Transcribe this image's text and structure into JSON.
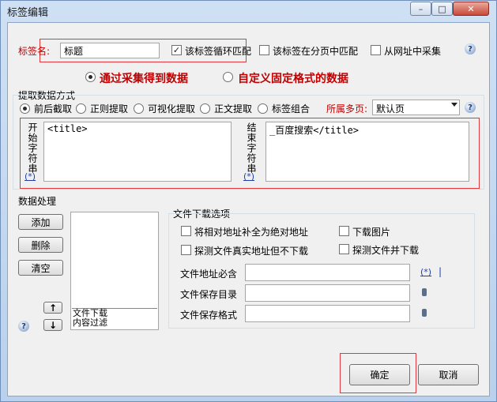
{
  "window": {
    "title": "标签编辑",
    "min": "–",
    "max": "□",
    "close": "✕"
  },
  "tagname": {
    "label": "标签名:",
    "value": "标题"
  },
  "options": {
    "loop_match": {
      "label": "该标签循环匹配",
      "checked": true
    },
    "in_pages": {
      "label": "该标签在分页中匹配",
      "checked": false
    },
    "from_url": {
      "label": "从网址中采集",
      "checked": false
    }
  },
  "mode": {
    "collect": "通过采集得到数据",
    "custom": "自定义固定格式的数据",
    "selected": "collect"
  },
  "extract": {
    "title": "提取数据方式",
    "methods": [
      "前后截取",
      "正则提取",
      "可视化提取",
      "正文提取",
      "标签组合"
    ],
    "selected_index": 0,
    "page_label": "所属多页:",
    "page_value": "默认页"
  },
  "start": {
    "label": "开始字符串",
    "star": "(*)",
    "value": "<title>"
  },
  "end": {
    "label": "结束字符串",
    "star": "(*)",
    "value": "_百度搜索</title>"
  },
  "processing": {
    "title": "数据处理",
    "buttons": {
      "add": "添加",
      "delete": "删除",
      "clear": "清空"
    },
    "list": [
      "文件下载",
      "内容过滤"
    ],
    "up": "↑",
    "down": "↓"
  },
  "download": {
    "title": "文件下载选项",
    "abs_path": {
      "label": "将相对地址补全为绝对地址",
      "checked": false
    },
    "download_images": {
      "label": "下载图片",
      "checked": false
    },
    "detect_no_download": {
      "label": "探测文件真实地址但不下载",
      "checked": false
    },
    "detect_download": {
      "label": "探测文件并下载",
      "checked": false
    },
    "url_must_contain": {
      "label": "文件地址必含",
      "star": "(*)",
      "value": ""
    },
    "save_dir": {
      "label": "文件保存目录",
      "value": ""
    },
    "save_format": {
      "label": "文件保存格式",
      "value": ""
    }
  },
  "footer": {
    "ok": "确定",
    "cancel": "取消"
  },
  "help_icon": "?"
}
